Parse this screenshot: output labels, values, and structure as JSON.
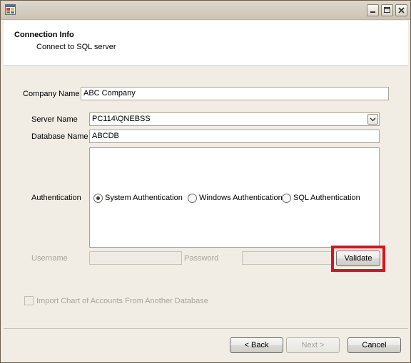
{
  "header": {
    "title": "Connection Info",
    "subtitle": "Connect to SQL server"
  },
  "form": {
    "company_name_label": "Company Name",
    "company_name_value": "ABC Company",
    "server_name_label": "Server Name",
    "server_name_value": "PC114\\QNEBSS",
    "database_name_label": "Database Name",
    "database_name_value": "ABCDB",
    "authentication_label": "Authentication",
    "auth_options": {
      "system": "System Authentication",
      "windows": "Windows Authentication",
      "sql": "SQL Authentication"
    },
    "auth_selected": "System Authentication",
    "username_label": "Username",
    "username_value": "",
    "password_label": "Password",
    "password_value": "",
    "validate_label": "Validate",
    "import_label": "Import Chart of Accounts From Another Database"
  },
  "footer": {
    "back_label": "< Back",
    "next_label": "Next >",
    "cancel_label": "Cancel"
  },
  "colors": {
    "highlight": "#e0101a",
    "window_bg": "#f1ede4"
  },
  "icons": {
    "app": "app-window-icon",
    "minimize": "minimize-icon",
    "maximize": "maximize-icon",
    "close": "close-icon",
    "combo": "chevron-down-icon"
  }
}
